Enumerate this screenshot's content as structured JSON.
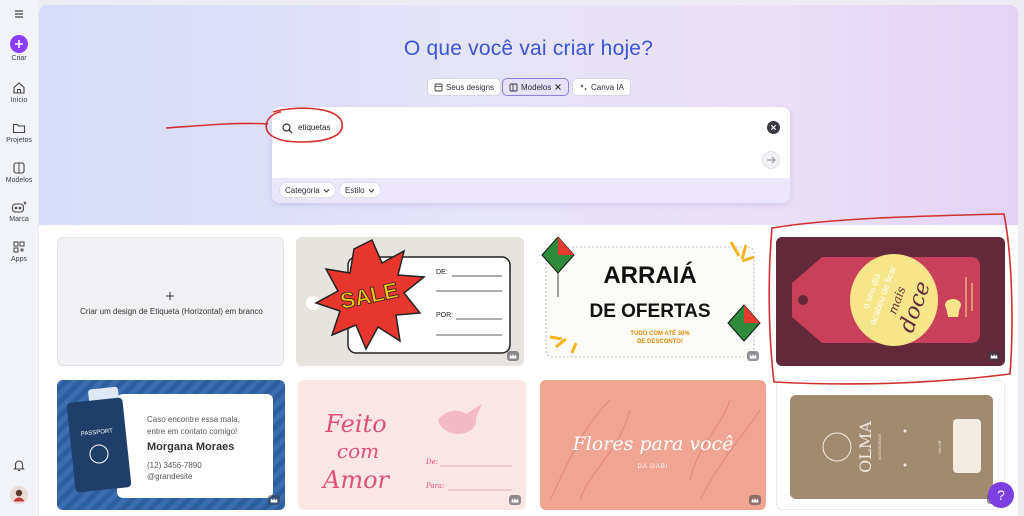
{
  "sidebar": {
    "create_label": "Criar",
    "items": [
      {
        "label": "Início",
        "icon": "home-icon"
      },
      {
        "label": "Projetos",
        "icon": "folder-icon"
      },
      {
        "label": "Modelos",
        "icon": "templates-icon"
      },
      {
        "label": "Marca",
        "icon": "brand-icon"
      },
      {
        "label": "Apps",
        "icon": "apps-icon"
      }
    ]
  },
  "hero": {
    "title": "O que você vai criar hoje?",
    "tabs": [
      {
        "label": "Seus designs",
        "active": false
      },
      {
        "label": "Modelos",
        "active": true
      },
      {
        "label": "Canva IA",
        "active": false
      }
    ]
  },
  "search": {
    "value": "etiquetas",
    "filters": [
      "Categoria",
      "Estilo"
    ]
  },
  "templates": {
    "blank_label": "Criar um design de Etiqueta (Horizontal) em branco",
    "sale": {
      "text": "SALE",
      "de": "DE:",
      "por": "POR:"
    },
    "arraia": {
      "line1": "ARRAIÁ",
      "line2": "DE OFERTAS",
      "line3": "TUDO COM ATÉ 30%",
      "line4": "DE DESCONTO!"
    },
    "doce": {
      "line1": "o seu dia",
      "line2": "acabou de ficar",
      "line3": "mais",
      "line4": "doce"
    },
    "passport": {
      "passport": "PASSPORT",
      "line1": "Caso encontre essa mala,",
      "line2": "entre em contato comigo!",
      "name": "Morgana Moraes",
      "phone": "(12) 3456-7890",
      "handle": "@grandesite"
    },
    "feito": {
      "line1": "Feito",
      "line2": "com",
      "line3": "Amor",
      "de": "De:",
      "para": "Para:"
    },
    "flores": {
      "line1": "Flores para você",
      "line2": "DA GABI"
    },
    "olma": {
      "brand": "OLMA",
      "sub": "ACESSÓRIOS",
      "valor": "VALOR"
    }
  },
  "help_label": "?",
  "colors": {
    "accent": "#7b3fe4",
    "title": "#3a55d6",
    "annotation": "#d32f2f"
  }
}
